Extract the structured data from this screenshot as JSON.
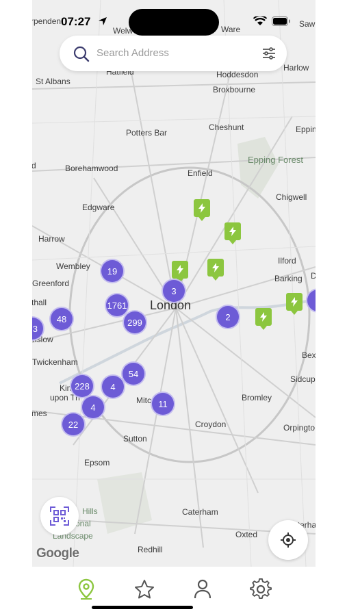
{
  "status_bar": {
    "time": "07:27"
  },
  "search": {
    "placeholder": "Search Address"
  },
  "map": {
    "attribution": "Google",
    "places": [
      "rpenden",
      "Welw",
      "Ware",
      "Saw",
      "Hatfield",
      "Hoddesdon",
      "Harlow",
      "St Albans",
      "Broxbourne",
      "Potters Bar",
      "Cheshunt",
      "Eppin",
      "d",
      "Borehamwood",
      "Enfield",
      "Epping Forest",
      "Edgware",
      "Chigwell",
      "Harrow",
      "Wembley",
      "Ilford",
      "Greenford",
      "Barking",
      "D",
      "thall",
      "London",
      "nslow",
      "Twickenham",
      "Bex",
      "Kin",
      "upon Th",
      "Sidcup",
      "mes",
      "Mitc",
      "Bromley",
      "Croydon",
      "Orpingto",
      "Sutton",
      "Epsom",
      "Caterham",
      "Hills",
      "onal",
      "Landscape",
      "Oxted",
      "Westerham",
      "Redhill"
    ],
    "clusters": [
      "19",
      "1761",
      "299",
      "3",
      "2",
      "48",
      "54",
      "228",
      "4",
      "4",
      "11",
      "22",
      "3",
      ""
    ],
    "charger_count": 7
  },
  "tabs": [
    "map",
    "favorites",
    "profile",
    "settings"
  ],
  "colors": {
    "cluster": "#6d5bd6",
    "charger": "#8cc63f",
    "active_tab": "#8cc63f",
    "inactive_tab": "#555555"
  }
}
